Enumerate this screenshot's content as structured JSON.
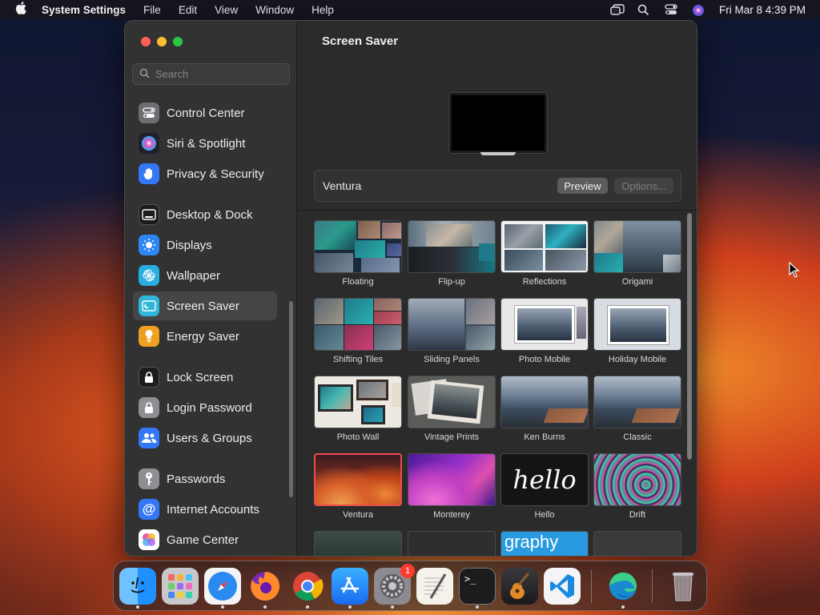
{
  "menubar": {
    "app_name": "System Settings",
    "menus": [
      "File",
      "Edit",
      "View",
      "Window",
      "Help"
    ],
    "clock": "Fri Mar 8  4:39 PM"
  },
  "sidebar": {
    "search_placeholder": "Search",
    "items": [
      {
        "label": "Control Center",
        "icon": "control-center-icon",
        "color": "#6e6e73"
      },
      {
        "label": "Siri & Spotlight",
        "icon": "siri-icon",
        "color": "#2a2a40"
      },
      {
        "label": "Privacy & Security",
        "icon": "hand-icon",
        "color": "#3478f6"
      },
      {
        "label": "Desktop & Dock",
        "icon": "desktop-dock-icon",
        "color": "#1c1c1e"
      },
      {
        "label": "Displays",
        "icon": "displays-icon",
        "color": "#2d86f5"
      },
      {
        "label": "Wallpaper",
        "icon": "wallpaper-icon",
        "color": "#28aee0"
      },
      {
        "label": "Screen Saver",
        "icon": "screen-saver-icon",
        "color": "#30b6d8",
        "selected": true
      },
      {
        "label": "Energy Saver",
        "icon": "battery-icon",
        "color": "#f0a020"
      },
      {
        "label": "Lock Screen",
        "icon": "lock-screen-icon",
        "color": "#1c1c1e"
      },
      {
        "label": "Login Password",
        "icon": "lock-icon",
        "color": "#8e8e93"
      },
      {
        "label": "Users & Groups",
        "icon": "users-icon",
        "color": "#3478f6"
      },
      {
        "label": "Passwords",
        "icon": "key-icon",
        "color": "#8e8e93"
      },
      {
        "label": "Internet Accounts",
        "icon": "at-icon",
        "color": "#3478f6"
      },
      {
        "label": "Game Center",
        "icon": "game-center-icon",
        "color": "#ffffff"
      }
    ]
  },
  "main": {
    "title": "Screen Saver",
    "selected_saver": "Ventura",
    "preview_button": "Preview",
    "options_button": "Options...",
    "savers": [
      {
        "label": "Floating"
      },
      {
        "label": "Flip-up"
      },
      {
        "label": "Reflections"
      },
      {
        "label": "Origami"
      },
      {
        "label": "Shifting Tiles"
      },
      {
        "label": "Sliding Panels"
      },
      {
        "label": "Photo Mobile"
      },
      {
        "label": "Holiday Mobile"
      },
      {
        "label": "Photo Wall"
      },
      {
        "label": "Vintage Prints"
      },
      {
        "label": "Ken Burns"
      },
      {
        "label": "Classic"
      },
      {
        "label": "Ventura",
        "selected": true
      },
      {
        "label": "Monterey"
      },
      {
        "label": "Hello",
        "thumb_text": "hello"
      },
      {
        "label": "Drift"
      },
      {
        "label": ""
      },
      {
        "label": ""
      },
      {
        "label": "",
        "thumb_text": "graphy"
      },
      {
        "label": ""
      }
    ]
  },
  "dock": {
    "apps": [
      {
        "name": "Finder",
        "icon": "finder-icon"
      },
      {
        "name": "Launchpad",
        "icon": "launchpad-icon"
      },
      {
        "name": "Safari",
        "icon": "safari-icon"
      },
      {
        "name": "Firefox",
        "icon": "firefox-icon"
      },
      {
        "name": "Chrome",
        "icon": "chrome-icon"
      },
      {
        "name": "App Store",
        "icon": "app-store-icon"
      },
      {
        "name": "System Settings",
        "icon": "settings-icon",
        "badge": "1"
      },
      {
        "name": "TextEdit",
        "icon": "textedit-icon"
      },
      {
        "name": "Terminal",
        "icon": "terminal-icon",
        "glyph": ">_"
      },
      {
        "name": "GarageBand",
        "icon": "garageband-icon"
      },
      {
        "name": "VS Code",
        "icon": "vscode-icon"
      },
      {
        "name": "Edge",
        "icon": "edge-icon"
      },
      {
        "name": "Trash",
        "icon": "trash-icon"
      }
    ]
  }
}
